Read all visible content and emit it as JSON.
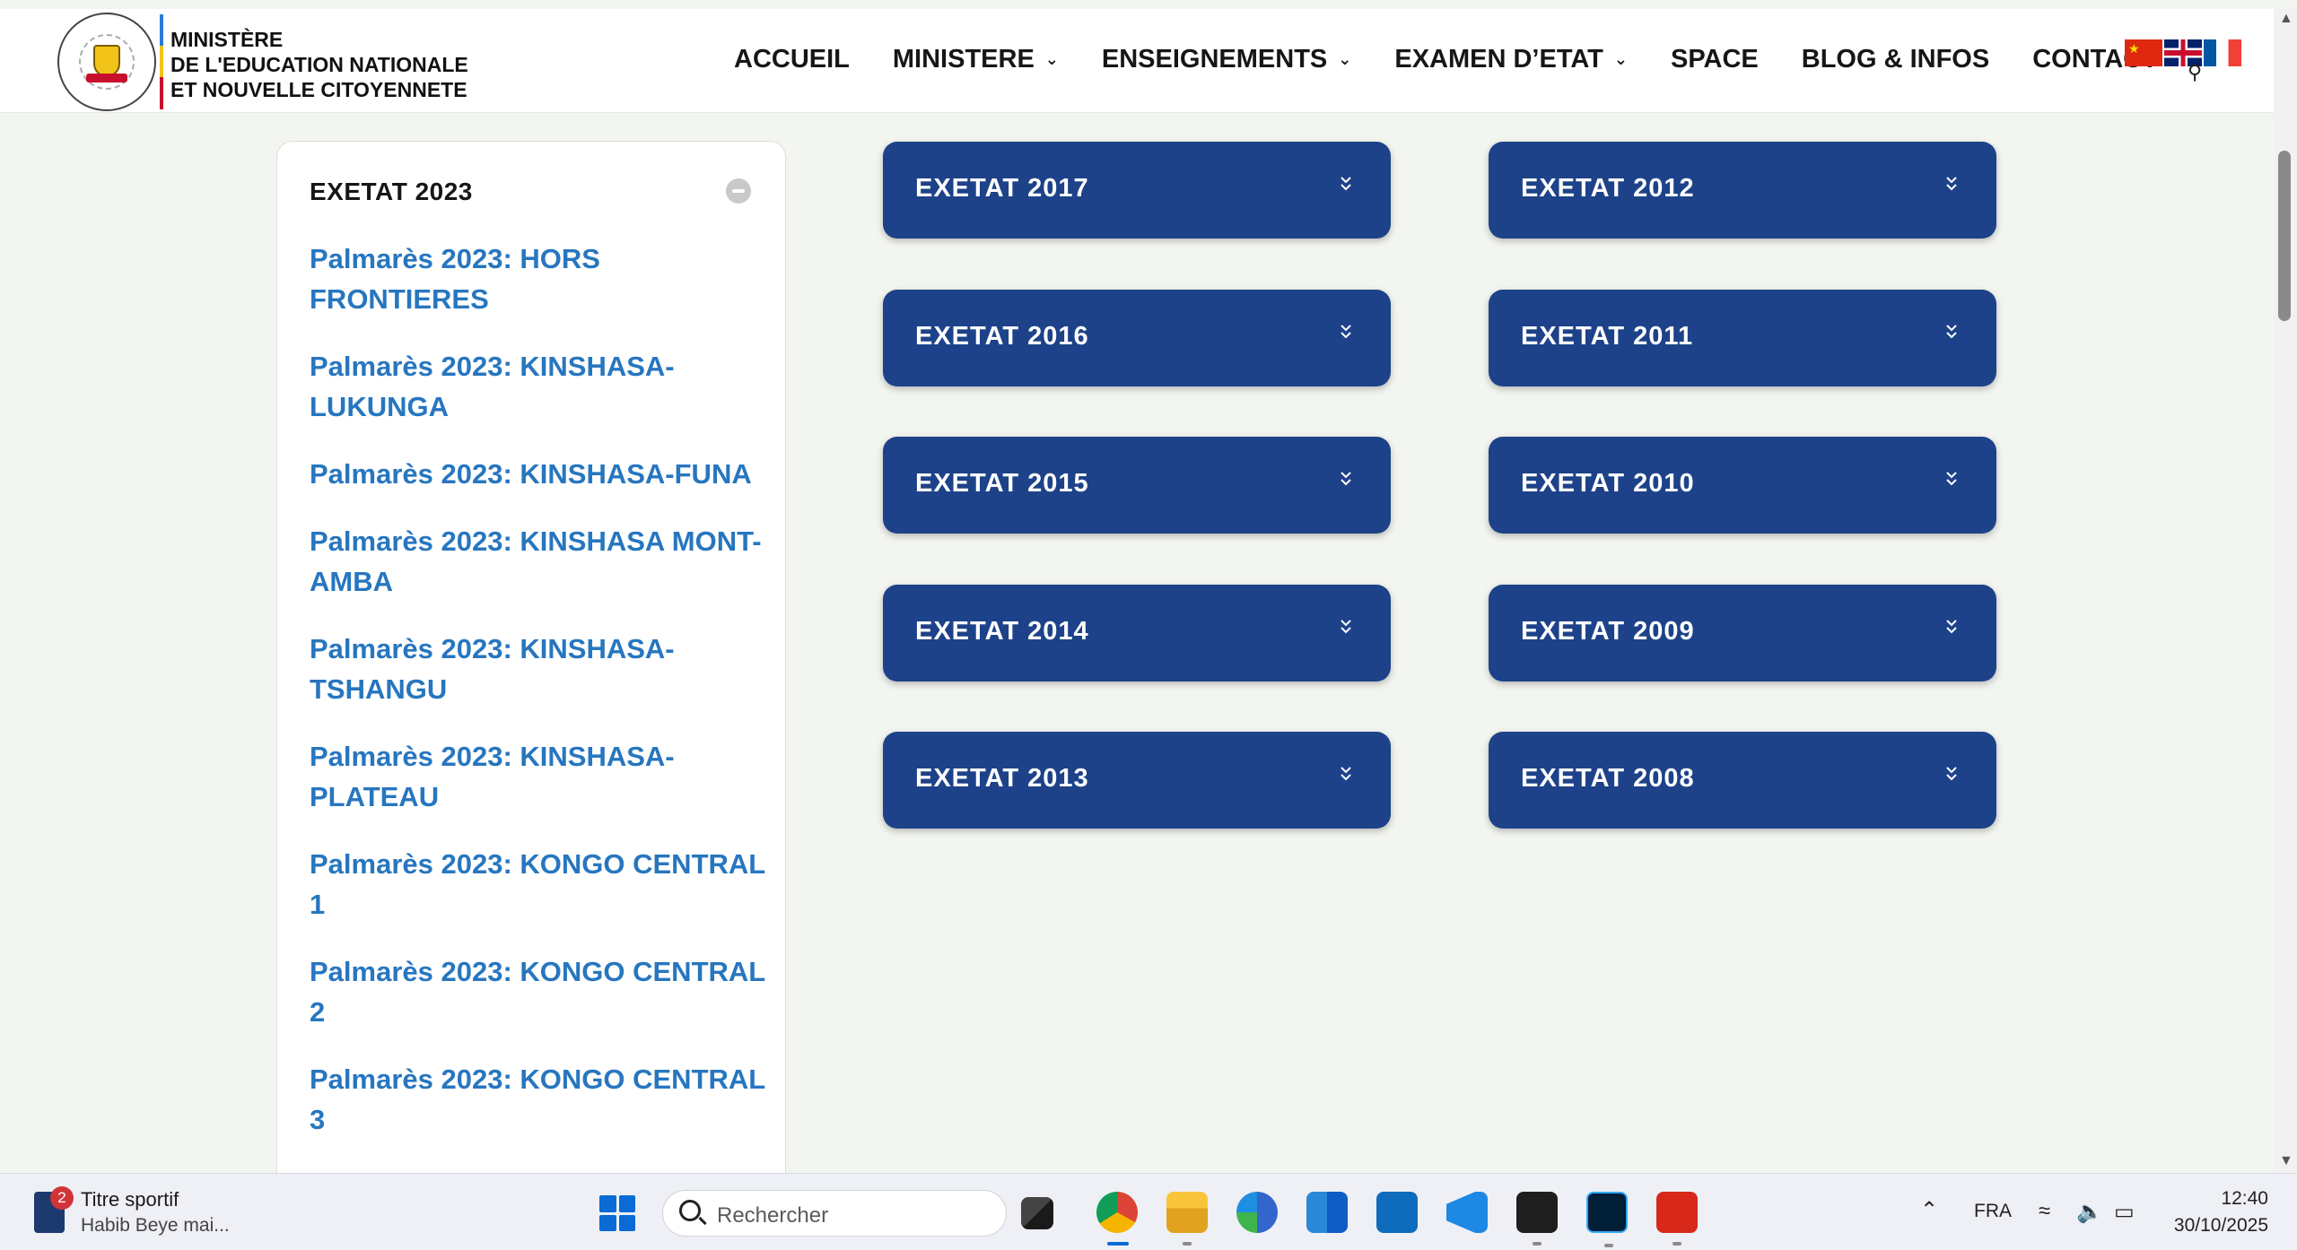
{
  "header": {
    "logo_lines": [
      "MINISTÈRE",
      "DE L'EDUCATION NATIONALE",
      "ET NOUVELLE CITOYENNETE"
    ],
    "nav": [
      {
        "label": "ACCUEIL",
        "has_dropdown": false
      },
      {
        "label": "MINISTERE",
        "has_dropdown": true
      },
      {
        "label": "ENSEIGNEMENTS",
        "has_dropdown": true
      },
      {
        "label": "EXAMEN D’ETAT",
        "has_dropdown": true
      },
      {
        "label": "SPACE",
        "has_dropdown": false
      },
      {
        "label": "BLOG & INFOS",
        "has_dropdown": false
      },
      {
        "label": "CONTACT",
        "has_dropdown": false
      }
    ],
    "languages": [
      "chinese-flag-icon",
      "uk-flag-icon",
      "france-flag-icon"
    ]
  },
  "sidebar": {
    "title": "EXETAT 2023",
    "links": [
      "Palmarès 2023: HORS FRONTIERES",
      "Palmarès 2023: KINSHASA-LUKUNGA",
      "Palmarès 2023: KINSHASA-FUNA",
      "Palmarès 2023: KINSHASA MONT-AMBA",
      "Palmarès 2023: KINSHASA-TSHANGU",
      "Palmarès 2023: KINSHASA-PLATEAU",
      "Palmarès 2023: KONGO CENTRAL 1",
      "Palmarès 2023: KONGO CENTRAL 2",
      "Palmarès 2023: KONGO CENTRAL 3"
    ]
  },
  "accordions": {
    "left": [
      "EXETAT 2017",
      "EXETAT 2016",
      "EXETAT 2015",
      "EXETAT 2014",
      "EXETAT 2013"
    ],
    "right": [
      "EXETAT 2012",
      "EXETAT 2011",
      "EXETAT 2010",
      "EXETAT 2009",
      "EXETAT 2008"
    ]
  },
  "taskbar": {
    "news_badge": "2",
    "news_title": "Titre sportif",
    "news_subtitle": "Habib Beye mai...",
    "search_placeholder": "Rechercher",
    "language": "FRA",
    "time": "12:40",
    "date": "30/10/2025"
  },
  "colors": {
    "accordion_bg": "#1d4289",
    "link": "#2776bf",
    "page_bg": "#f3f5f0"
  }
}
